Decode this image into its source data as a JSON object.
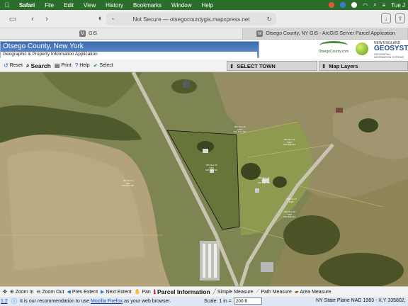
{
  "menubar": {
    "apple": "",
    "items": [
      "Safari",
      "File",
      "Edit",
      "View",
      "History",
      "Bookmarks",
      "Window",
      "Help"
    ],
    "clock": "Tue J"
  },
  "browser": {
    "url": "Not Secure — otsegocountygis.mapxpress.net",
    "tabs": [
      {
        "favicon": "M",
        "label": "GIS"
      },
      {
        "favicon": "M",
        "label": "Otsego County, NY GIS - ArcGIS Server Parcel Application"
      }
    ]
  },
  "header": {
    "title": "Otsego County, New York",
    "subtitle": "Geographic & Property Information Application",
    "county_logo_text": "OtsegoCounty.com",
    "brand_small": "NEW ENGLAND",
    "brand_large": "GEOSYSTE",
    "brand_tagline": "GEOGRAPHIC INFORMATION SYSTEMS"
  },
  "app_toolbar": {
    "reset": "Reset",
    "search": "Search",
    "print": "Print",
    "help": "Help",
    "select": "Select",
    "select_town": "SELECT TOWN",
    "map_layers": "Map Layers"
  },
  "map": {
    "parcel_labels": [
      {
        "text": "180.19-1-12\n1000\n100 Main Rd"
      },
      {
        "text": "180.19-1-10\n1000\n100 Main Rd"
      },
      {
        "text": "180.19-1-11\n1000\n100 Main Rd"
      },
      {
        "text": "180.19-1-13\n1000\n100 Main Rd"
      },
      {
        "text": "180.19-1-9\n1000\n100 Main Rd"
      },
      {
        "text": "180.19-1-14\n1000\n100 Main Rd"
      },
      {
        "text": "180.19-1-8\n1000"
      }
    ]
  },
  "bottom_toolbar": {
    "zoom_in": "Zoom In",
    "zoom_out": "Zoom Out",
    "prev_extent": "Prev Extent",
    "next_extent": "Next Extent",
    "pan": "Pan",
    "parcel_information": "Parcel Information",
    "simple_measure": "Simple Measure",
    "path_measure": "Path Measure",
    "area_measure": "Area Measure"
  },
  "status": {
    "version": "1.2",
    "notice_prefix": "It is our recommendation to use",
    "notice_link": "Mozilla Firefox",
    "notice_suffix": "as your web browser.",
    "scale_label": "Scale: 1 in =",
    "scale_value": "200 ft",
    "coords": "NY State Plane NAD 1983 - X,Y 335802,"
  }
}
